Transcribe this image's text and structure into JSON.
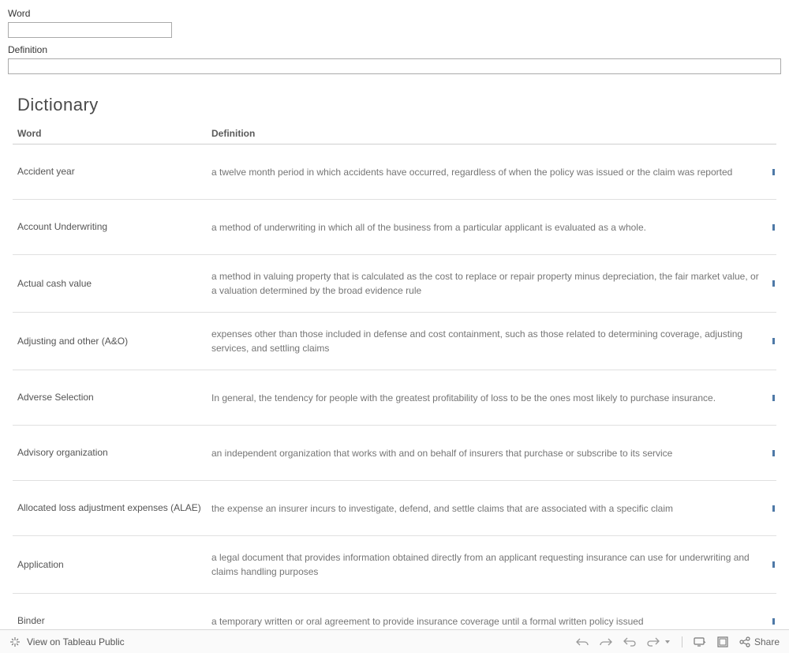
{
  "filters": {
    "word_label": "Word",
    "word_value": "",
    "definition_label": "Definition",
    "definition_value": ""
  },
  "section_title": "Dictionary",
  "columns": {
    "word": "Word",
    "definition": "Definition"
  },
  "rows": [
    {
      "word": "Accident year",
      "definition": "a twelve month period in which accidents have occurred, regardless of when the policy was issued or the claim was reported"
    },
    {
      "word": "Account Underwriting",
      "definition": "a method of underwriting in which all of the business from a particular applicant is evaluated as a whole."
    },
    {
      "word": "Actual cash value",
      "definition": "a method in valuing property that is calculated as the cost to replace or repair property minus depreciation, the fair market value, or a valuation determined by the broad evidence rule"
    },
    {
      "word": "Adjusting and other (A&O)",
      "definition": "expenses other than those included in defense and cost containment, such as those related to determining coverage, adjusting services, and settling claims"
    },
    {
      "word": "Adverse Selection",
      "definition": "In general, the tendency for people with the greatest profitability of loss to be the ones most likely to purchase insurance."
    },
    {
      "word": "Advisory organization",
      "definition": "an independent organization that works with and on behalf of insurers that purchase or subscribe to its service"
    },
    {
      "word": "Allocated loss adjustment expenses (ALAE)",
      "definition": "the expense an insurer incurs to investigate, defend, and settle claims that are associated with a specific claim"
    },
    {
      "word": "Application",
      "definition": "a legal document that provides information obtained directly from an applicant requesting insurance can use for underwriting and claims handling purposes"
    },
    {
      "word": "Binder",
      "definition": "a temporary written or oral agreement to provide insurance coverage until a formal written policy issued"
    }
  ],
  "toolbar": {
    "view_label": "View on Tableau Public",
    "share_label": "Share"
  }
}
